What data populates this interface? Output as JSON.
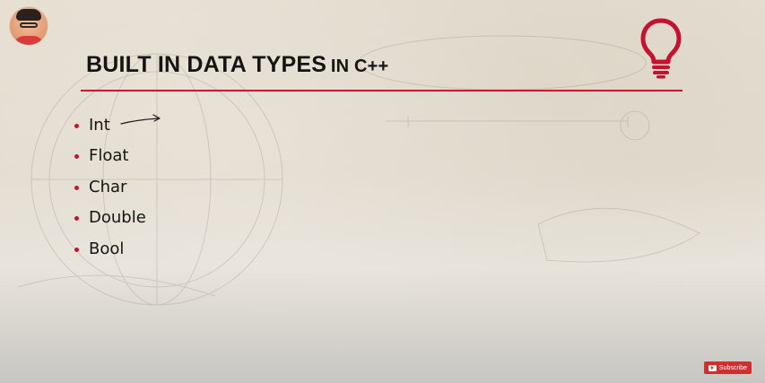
{
  "slide": {
    "title_main": "BUILT IN DATA TYPES",
    "title_suffix": "IN C++",
    "accent_color": "#c4122f",
    "title_icon": "lightbulb-icon",
    "bullets": [
      {
        "label": "Int"
      },
      {
        "label": "Float"
      },
      {
        "label": "Char"
      },
      {
        "label": "Double"
      },
      {
        "label": "Bool"
      }
    ],
    "annotation_icon": "hand-drawn-arrow-icon"
  },
  "channel": {
    "avatar_icon": "presenter-avatar",
    "subscribe_label": "Subscribe",
    "subscribe_color": "#d12e2e"
  }
}
